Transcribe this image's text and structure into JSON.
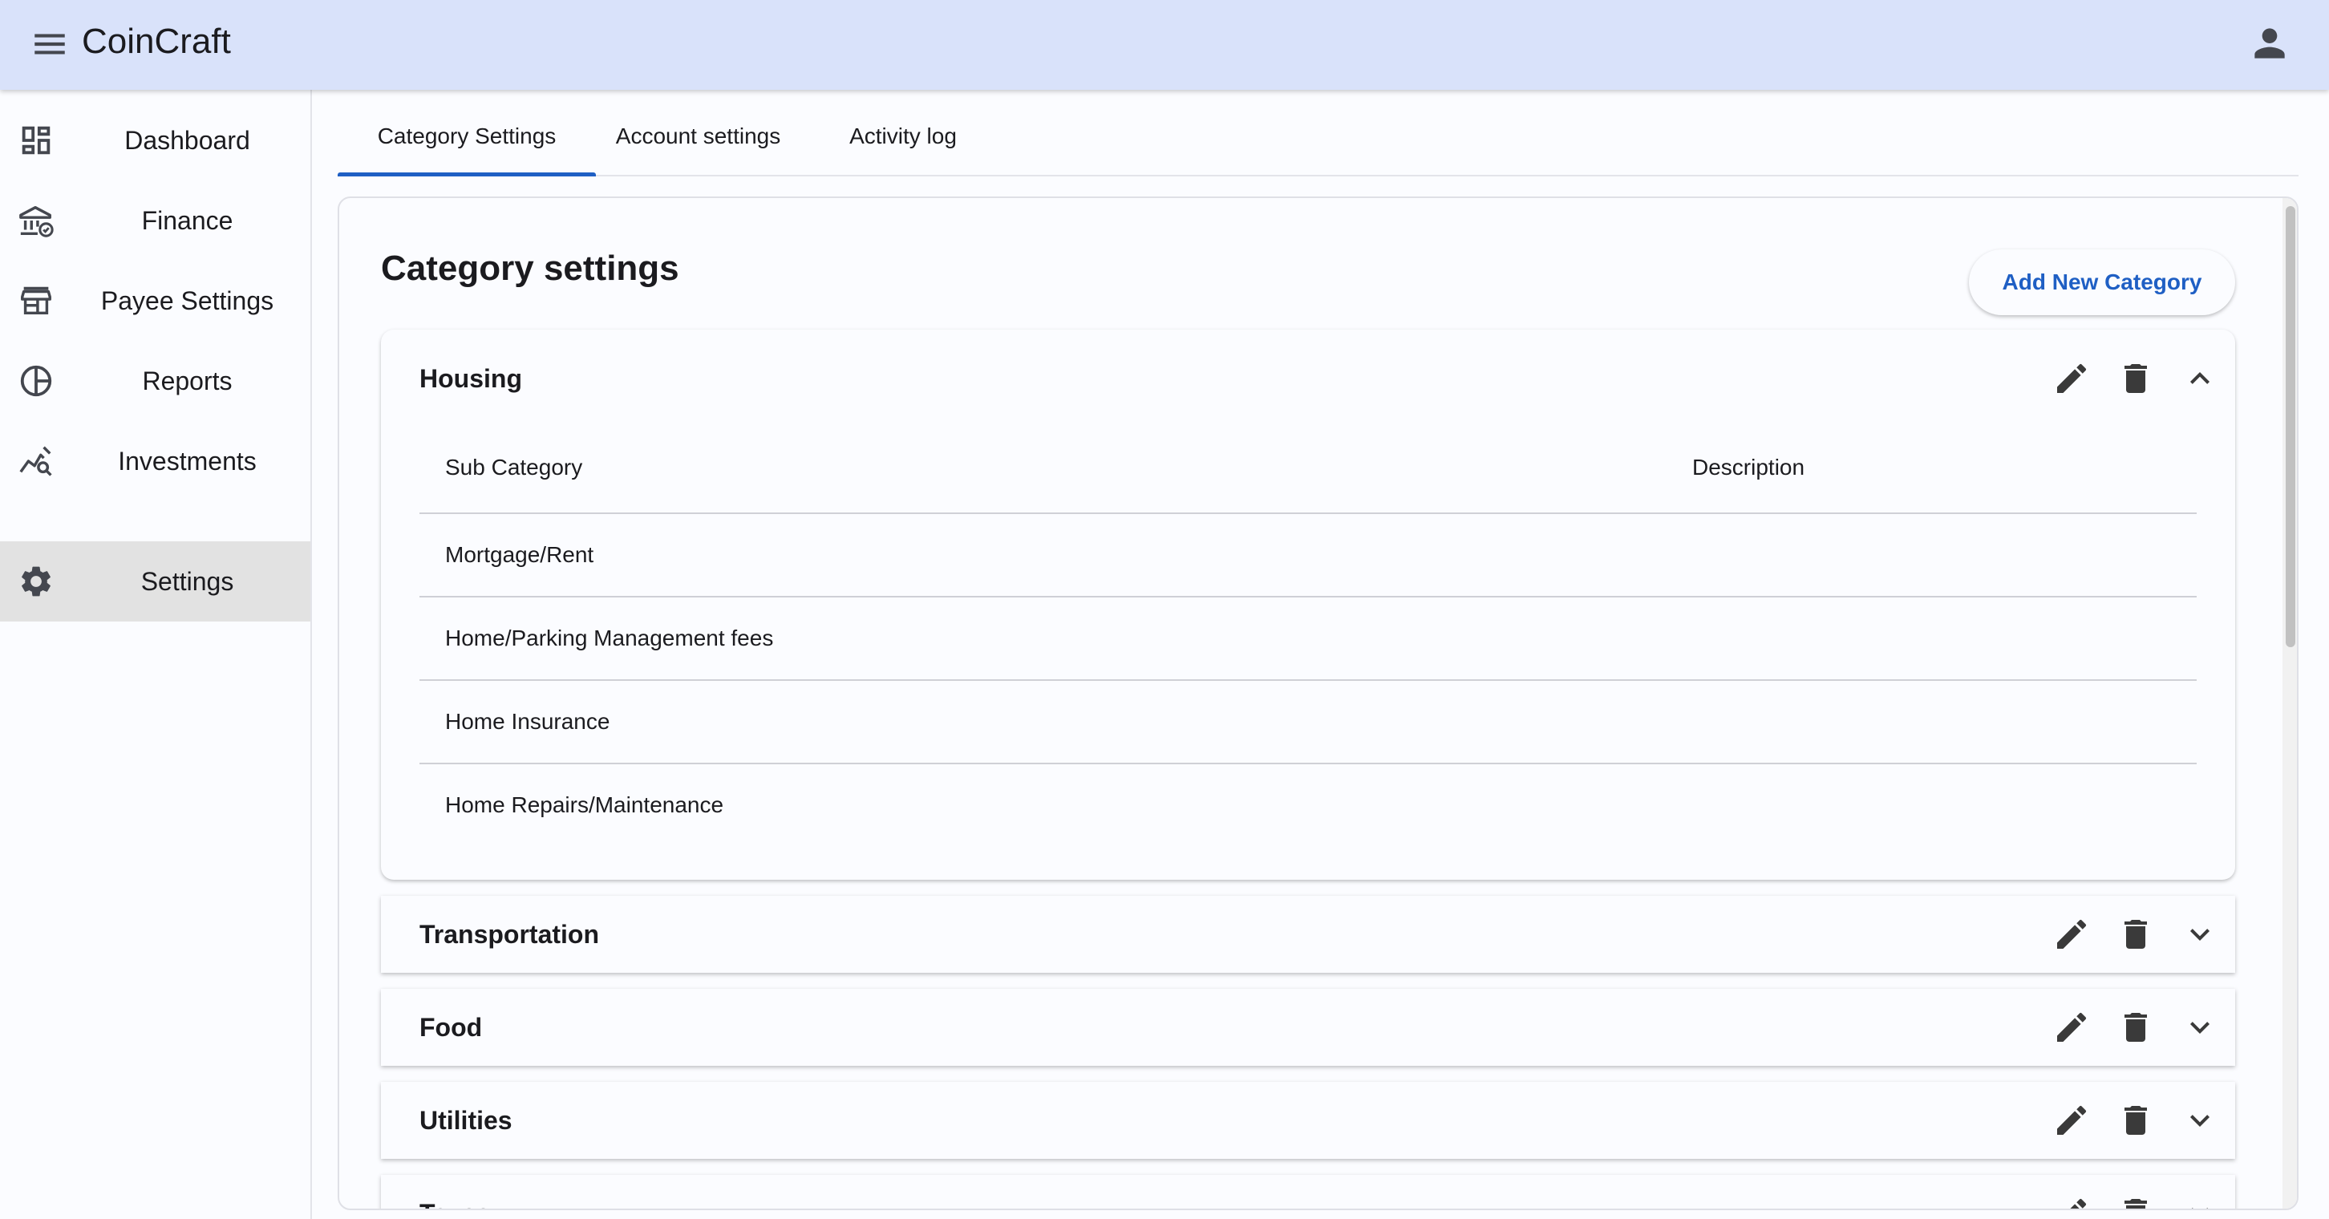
{
  "app": {
    "title": "CoinCraft"
  },
  "sidebar": {
    "items": [
      {
        "label": "Dashboard",
        "icon": "dashboard-icon"
      },
      {
        "label": "Finance",
        "icon": "bank-icon"
      },
      {
        "label": "Payee Settings",
        "icon": "storefront-icon"
      },
      {
        "label": "Reports",
        "icon": "pie-chart-icon"
      },
      {
        "label": "Investments",
        "icon": "query-stats-icon"
      },
      {
        "label": "Settings",
        "icon": "gear-icon",
        "active": true
      }
    ]
  },
  "tabs": [
    {
      "label": "Category Settings",
      "active": true
    },
    {
      "label": "Account settings"
    },
    {
      "label": "Activity log"
    }
  ],
  "main": {
    "title": "Category settings",
    "add_button": "Add New Category",
    "table_headers": {
      "sub_category": "Sub Category",
      "description": "Description"
    },
    "categories": [
      {
        "name": "Housing",
        "expanded": true,
        "subcategories": [
          {
            "name": "Mortgage/Rent",
            "description": ""
          },
          {
            "name": "Home/Parking Management fees",
            "description": ""
          },
          {
            "name": "Home Insurance",
            "description": ""
          },
          {
            "name": "Home Repairs/Maintenance",
            "description": ""
          }
        ]
      },
      {
        "name": "Transportation",
        "expanded": false
      },
      {
        "name": "Food",
        "expanded": false
      },
      {
        "name": "Utilities",
        "expanded": false
      },
      {
        "name": "Taxes",
        "expanded": false
      }
    ]
  },
  "colors": {
    "app_bar": "#d9e2fa",
    "accent": "#1f5fc4",
    "active_nav": "#e2e2e2"
  }
}
